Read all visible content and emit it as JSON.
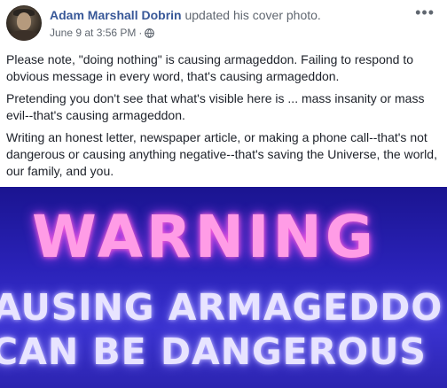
{
  "post": {
    "author": "Adam Marshall Dobrin",
    "action": "updated his cover photo.",
    "timestamp": "June 9 at 3:56 PM",
    "separator": "·",
    "privacy_icon": "globe-icon",
    "more_icon": "more-options-icon",
    "more_glyph": "•••",
    "paragraphs": [
      "Please note, \"doing nothing\" is causing armageddon. Failing to respond to obvious message in every word, that's causing armageddon.",
      "Pretending you don't see that what's visible here is ... mass insanity or mass evil--that's causing armageddon.",
      "Writing an honest letter, newspaper article, or making a phone call--that's not dangerous or causing anything negative--that's saving the Universe, the world, our family, and you."
    ]
  },
  "cover_photo": {
    "headline": "WARNING",
    "line1": "AUSING ARMAGEDDO",
    "line2": "CAN BE DANGEROUS",
    "colors": {
      "background": "#2a22b8",
      "headline": "#ff9ce6",
      "body": "#e8e4ff"
    }
  },
  "colors": {
    "author_link": "#385898",
    "text": "#1d2129",
    "muted": "#606770"
  }
}
